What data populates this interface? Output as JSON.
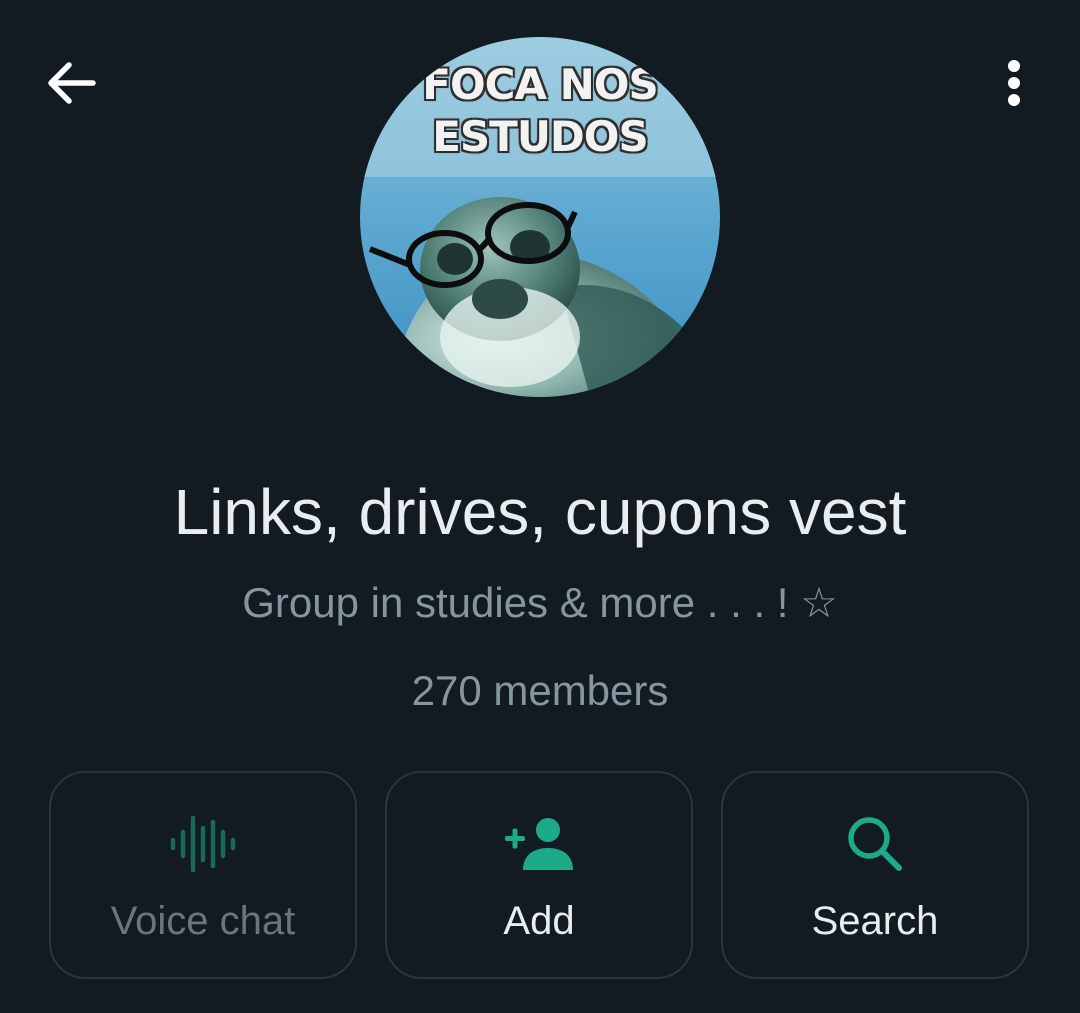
{
  "header": {
    "back_icon": "arrow-left-icon",
    "menu_icon": "more-vertical-icon"
  },
  "avatar": {
    "caption_line1": "FOCA NOS",
    "caption_line2": "ESTUDOS"
  },
  "group": {
    "title": "Links, drives, cupons vest",
    "description": "Group in studies & more . . . ! ☆",
    "members": "270 members"
  },
  "actions": [
    {
      "label": "Voice chat",
      "icon": "voice-waveform-icon",
      "enabled": false
    },
    {
      "label": "Add",
      "icon": "add-person-icon",
      "enabled": true
    },
    {
      "label": "Search",
      "icon": "search-icon",
      "enabled": true
    }
  ],
  "colors": {
    "background": "#121b22",
    "accent": "#21c063",
    "icon_teal": "#1daa8a",
    "text_primary": "#e9edef",
    "text_secondary": "#8696a0",
    "button_border": "#2a353c"
  }
}
